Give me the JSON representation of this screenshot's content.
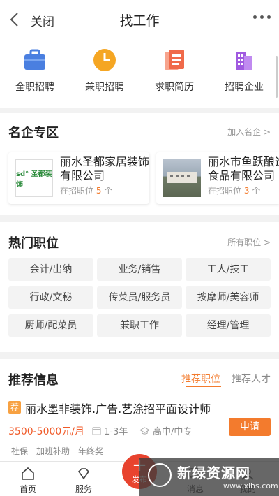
{
  "header": {
    "close_label": "关闭",
    "title": "找工作"
  },
  "categories": [
    {
      "label": "全职招聘",
      "icon": "briefcase-icon",
      "color": "#4a7fe0"
    },
    {
      "label": "兼职招聘",
      "icon": "clock-icon",
      "color": "#f5a623"
    },
    {
      "label": "求职简历",
      "icon": "resume-icon",
      "color": "#f06a4a"
    },
    {
      "label": "招聘企业",
      "icon": "building-icon",
      "color": "#a05ae0"
    }
  ],
  "famous": {
    "title": "名企专区",
    "link": "加入名企 >",
    "companies": [
      {
        "name": "丽水圣都家居装饰有限公司",
        "logo_text": "sd° 圣都装饰",
        "pos_label": "在招职位",
        "count": "5",
        "unit": "个"
      },
      {
        "name": "丽水市鱼跃酿造食品有限公司",
        "pos_label": "在招职位",
        "count": "3",
        "unit": "个"
      }
    ]
  },
  "hot": {
    "title": "热门职位",
    "link": "所有职位 >",
    "jobs": [
      "会计/出纳",
      "业务/销售",
      "工人/技工",
      "行政/文秘",
      "传菜员/服务员",
      "按摩师/美容师",
      "厨师/配菜员",
      "兼职工作",
      "经理/管理"
    ]
  },
  "recommend": {
    "title": "推荐信息",
    "tab_active": "推荐职位",
    "tab_other": "推荐人才",
    "badge": "荐",
    "job_title": "丽水墨非装饰.广告.艺涂招平面设计师",
    "salary": "3500-5000元/月",
    "experience": "1-3年",
    "education": "高中/中专",
    "apply_label": "申请",
    "benefits": [
      "社保",
      "加班补助",
      "年终奖"
    ]
  },
  "nav": {
    "home": "首页",
    "service": "服务",
    "publish": "发布",
    "message": "消息",
    "mine": "我的"
  },
  "watermark": {
    "text": "新绿资源网",
    "url": "www.xlhs.com"
  },
  "colors": {
    "accent": "#f37b2d",
    "publish": "#e8432e"
  }
}
